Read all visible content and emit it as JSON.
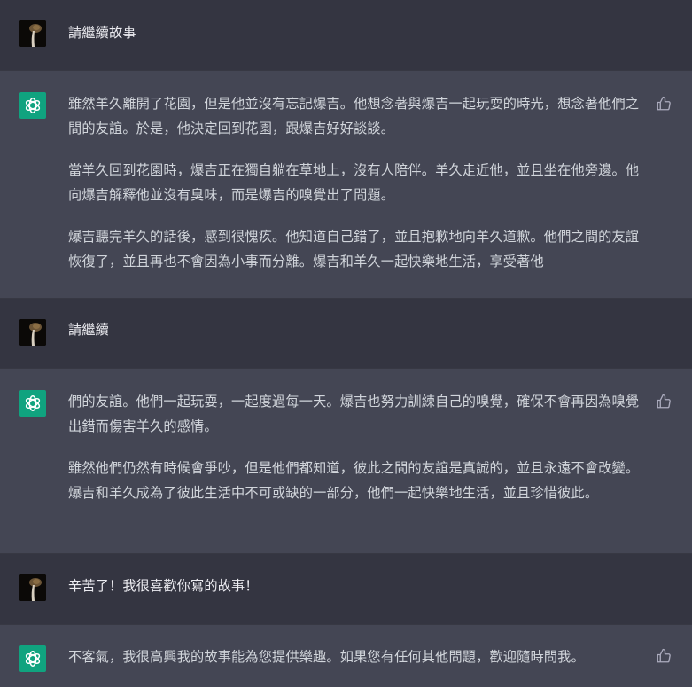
{
  "conversation": {
    "messages": [
      {
        "role": "user",
        "avatar_icon": "user-avatar-photo",
        "paragraphs": [
          "請繼續故事"
        ]
      },
      {
        "role": "assistant",
        "avatar_icon": "openai-logo-icon",
        "paragraphs": [
          "雖然羊久離開了花園，但是他並沒有忘記爆吉。他想念著與爆吉一起玩耍的時光，想念著他們之間的友誼。於是，他決定回到花園，跟爆吉好好談談。",
          "當羊久回到花園時，爆吉正在獨自躺在草地上，沒有人陪伴。羊久走近他，並且坐在他旁邊。他向爆吉解釋他並沒有臭味，而是爆吉的嗅覺出了問題。",
          "爆吉聽完羊久的話後，感到很愧疚。他知道自己錯了，並且抱歉地向羊久道歉。他們之間的友誼恢復了，並且再也不會因為小事而分離。爆吉和羊久一起快樂地生活，享受著他"
        ]
      },
      {
        "role": "user",
        "avatar_icon": "user-avatar-photo",
        "paragraphs": [
          "請繼續"
        ]
      },
      {
        "role": "assistant",
        "avatar_icon": "openai-logo-icon",
        "paragraphs": [
          "們的友誼。他們一起玩耍，一起度過每一天。爆吉也努力訓練自己的嗅覺，確保不會再因為嗅覺出錯而傷害羊久的感情。",
          "雖然他們仍然有時候會爭吵，但是他們都知道，彼此之間的友誼是真誠的，並且永遠不會改變。爆吉和羊久成為了彼此生活中不可或缺的一部分，他們一起快樂地生活，並且珍惜彼此。"
        ]
      },
      {
        "role": "user",
        "avatar_icon": "user-avatar-photo",
        "paragraphs": [
          "辛苦了！我很喜歡你寫的故事！"
        ]
      },
      {
        "role": "assistant",
        "avatar_icon": "openai-logo-icon",
        "paragraphs": [
          "不客氣，我很高興我的故事能為您提供樂趣。如果您有任何其他問題，歡迎隨時問我。"
        ]
      }
    ],
    "feedback_icon": "thumbs-up-icon",
    "colors": {
      "user_bg": "#343541",
      "assistant_bg": "#444654",
      "text": "#d1d5db",
      "openai_green": "#10a37f"
    }
  }
}
